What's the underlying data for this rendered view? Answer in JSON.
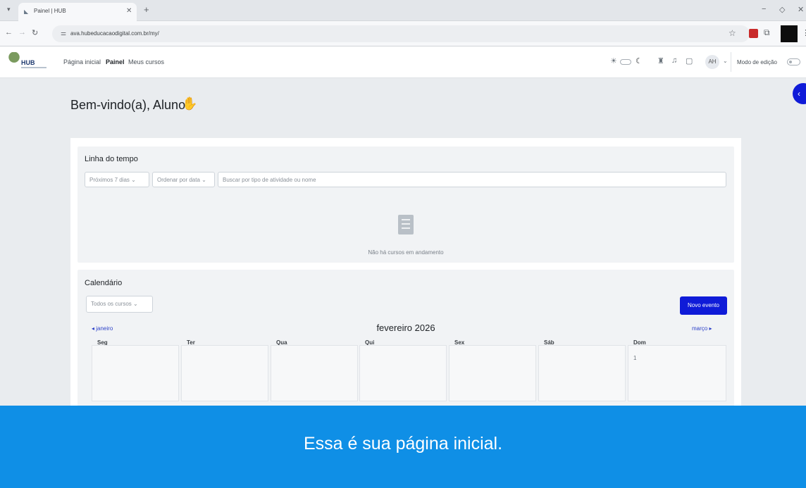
{
  "browser": {
    "tab_title": "Painel | HUB",
    "url": "ava.hubeducacaodigital.com.br/my/"
  },
  "moodle_nav": {
    "logo_text": "HUB",
    "links": [
      "Página inicial",
      "Painel",
      "Meus cursos"
    ],
    "active_link": "Painel",
    "avatar_initials": "AH",
    "edit_mode_label": "Modo de edição"
  },
  "page": {
    "welcome": "Bem-vindo(a), Aluno!"
  },
  "timeline": {
    "title": "Linha do tempo",
    "filter_days": "Próximos 7 dias",
    "sort": "Ordenar por data",
    "search_placeholder": "Buscar por tipo de atividade ou nome",
    "empty_text": "Não há cursos em andamento"
  },
  "calendar": {
    "title": "Calendário",
    "course_filter": "Todos os cursos",
    "new_event_label": "Novo evento",
    "prev_month": "janeiro",
    "current_month": "fevereiro 2026",
    "next_month": "março",
    "weekdays": [
      "Seg",
      "Ter",
      "Qua",
      "Qui",
      "Sex",
      "Sáb",
      "Dom"
    ],
    "first_day": "1"
  },
  "banner": {
    "text": "Essa é sua página inicial."
  },
  "colors": {
    "primary": "#0f1bd8",
    "banner": "#0f8fe6"
  }
}
